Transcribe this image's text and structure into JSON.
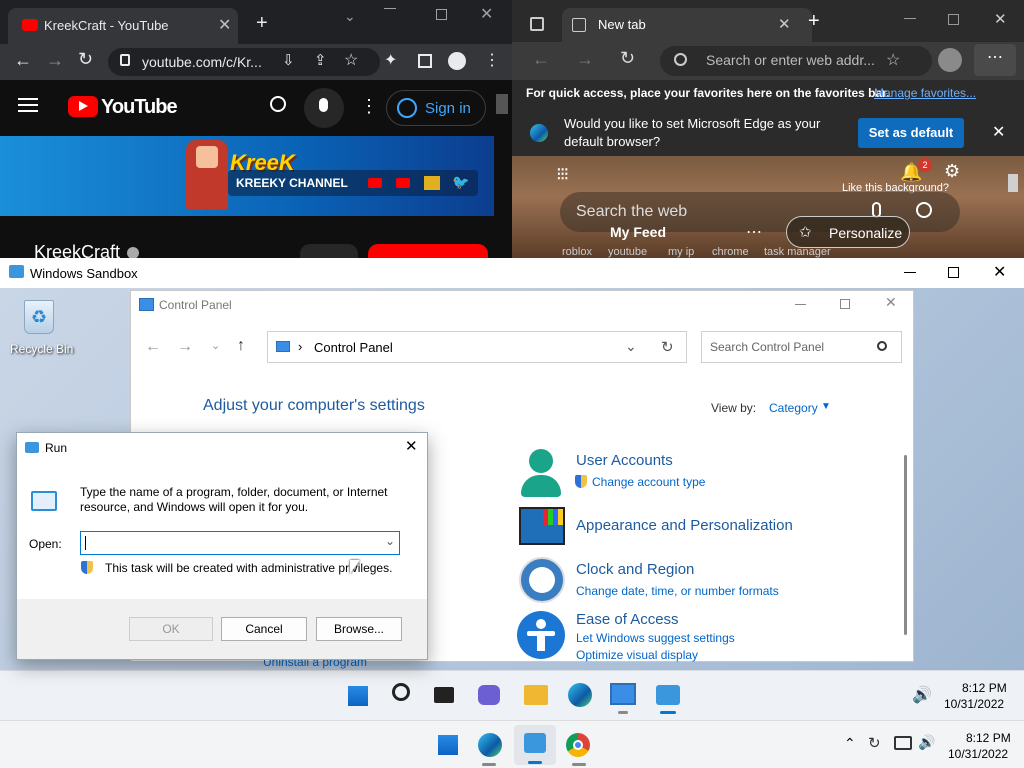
{
  "chrome": {
    "tab_title": "KreekCraft - YouTube",
    "url": "youtube.com/c/Kr...",
    "youtube": {
      "logo_text": "YouTube",
      "sign_in": "Sign in",
      "banner_text": "KREEKY CHANNEL",
      "channel_name": "KreekCraft"
    }
  },
  "edge": {
    "tab_title": "New tab",
    "address_placeholder": "Search or enter web addr...",
    "favbar_text": "For quick access, place your favorites here on the favorites bar.",
    "favbar_link": "Manage favorites...",
    "prompt_line1": "Would you like to set Microsoft Edge as your",
    "prompt_line2": "default browser?",
    "set_default": "Set as default",
    "notification_count": "2",
    "like_bg": "Like this background?",
    "search_placeholder": "Search the web",
    "my_feed": "My Feed",
    "personalize": "Personalize",
    "quicklinks": [
      "roblox",
      "youtube",
      "my ip",
      "chrome",
      "task manager"
    ]
  },
  "sandbox": {
    "title": "Windows Sandbox",
    "recycle_bin": "Recycle Bin",
    "clock_time": "8:12 PM",
    "clock_date": "10/31/2022"
  },
  "control_panel": {
    "title": "Control Panel",
    "breadcrumb": "Control Panel",
    "search_placeholder": "Search Control Panel",
    "heading": "Adjust your computer's settings",
    "view_by_label": "View by:",
    "view_by_value": "Category",
    "uninstall_partial": "Uninstall a program",
    "categories": [
      {
        "title": "User Accounts",
        "links": [
          "Change account type"
        ]
      },
      {
        "title": "Appearance and Personalization",
        "links": []
      },
      {
        "title": "Clock and Region",
        "links": [
          "Change date, time, or number formats"
        ]
      },
      {
        "title": "Ease of Access",
        "links": [
          "Let Windows suggest settings",
          "Optimize visual display"
        ]
      }
    ]
  },
  "run": {
    "title": "Run",
    "description_line1": "Type the name of a program, folder, document, or Internet",
    "description_line2": "resource, and Windows will open it for you.",
    "open_label": "Open:",
    "input_value": "",
    "admin_note": "This task will be created with administrative privileges.",
    "ok": "OK",
    "cancel": "Cancel",
    "browse": "Browse..."
  },
  "host_taskbar": {
    "clock_time": "8:12 PM",
    "clock_date": "10/31/2022"
  },
  "colors": {
    "youtube_red": "#ff0000",
    "edge_blue": "#0f6cbd",
    "cp_heading": "#1e5b9e",
    "cp_link": "#0066cc",
    "win_blue": "#0078d4"
  }
}
